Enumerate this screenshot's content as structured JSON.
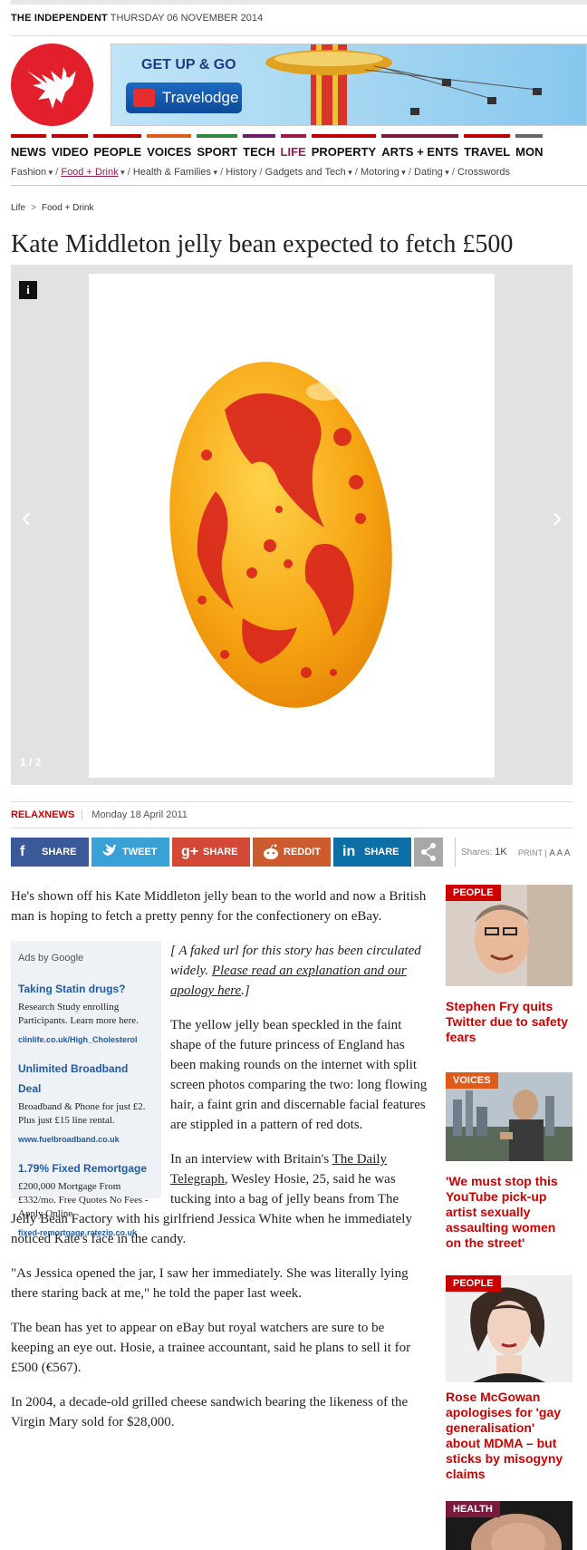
{
  "topbar": {
    "brand": "THE INDEPENDENT",
    "date": "THURSDAY 06 NOVEMBER 2014"
  },
  "ad_banner": {
    "headline": "GET UP & GO",
    "button": "Travelodge"
  },
  "main_nav": [
    "NEWS",
    "VIDEO",
    "PEOPLE",
    "VOICES",
    "SPORT",
    "TECH",
    "LIFE",
    "PROPERTY",
    "ARTS + ENTS",
    "TRAVEL",
    "MON"
  ],
  "nav_colors": [
    "#c00000",
    "#c00000",
    "#c00000",
    "#e05a1a",
    "#2c8a3c",
    "#6b1d6b",
    "#9b1a4b",
    "#c00000",
    "#7a1a3c",
    "#c00000",
    "#666666"
  ],
  "sub_nav": [
    "Fashion",
    "Food + Drink",
    "Health & Families",
    "History",
    "Gadgets and Tech",
    "Motoring",
    "Dating",
    "Crosswords"
  ],
  "sub_nav_dropdown": [
    true,
    true,
    true,
    false,
    true,
    true,
    true,
    false
  ],
  "breadcrumb": {
    "section": "Life",
    "sub": "Food + Drink"
  },
  "headline": "Kate Middleton jelly bean expected to fetch £500",
  "gallery": {
    "info": "i",
    "counter": "1 / 2"
  },
  "byline": {
    "source": "RELAXNEWS",
    "date": "Monday 18 April 2011"
  },
  "share": {
    "facebook": "SHARE",
    "twitter": "TWEET",
    "googleplus": "SHARE",
    "reddit": "REDDIT",
    "linkedin": "SHARE",
    "shares_label": "Shares:",
    "shares_count": "1K",
    "print": "PRINT",
    "text_size": "A A A"
  },
  "article": {
    "p1": "He's shown off his Kate Middleton jelly bean to the world and now a British man is hoping to fetch a pretty penny for the confectionery on eBay.",
    "note_pre": "[ A faked url for this story has been circulated widely. ",
    "note_link": "Please read an explanation and our apology here",
    "note_post": ".]",
    "p2": "The yellow jelly bean speckled in the faint shape of the future princess of England has been making rounds on the internet with split screen photos comparing the two: long flowing hair, a faint grin and discernable facial features are stippled in a pattern of red dots.",
    "p3_pre": "In an interview with Britain's ",
    "p3_link": "The Daily Telegraph",
    "p3_post": ", Wesley Hosie, 25, said he was tucking into a bag of jelly beans from The Jelly Bean Factory with his girlfriend Jessica White when he immediately noticed Kate's face in the candy.",
    "p4": "\"As Jessica opened the jar, I saw her immediately. She was literally lying there staring back at me,\" he told the paper last week.",
    "p5": "The bean has yet to appear on eBay but royal watchers are sure to be keeping an eye out. Hosie, a trainee accountant, said he plans to sell it for £500 (€567).",
    "p6": "In 2004, a decade-old grilled cheese sandwich bearing the likeness of the Virgin Mary sold for $28,000."
  },
  "google_ads": {
    "heading": "Ads by Google",
    "ads": [
      {
        "title": "Taking Statin drugs?",
        "body": "Research Study enrolling Participants. Learn more here.",
        "url": "clinlife.co.uk/High_Cholesterol"
      },
      {
        "title": "Unlimited Broadband Deal",
        "body": "Broadband & Phone for just £2. Plus just £15 line rental.",
        "url": "www.fuelbroadband.co.uk"
      },
      {
        "title": "1.79% Fixed Remortgage",
        "body": "£200,000 Mortgage From £332/mo. Free Quotes No Fees - Apply Online",
        "url": "fixed-remortgage.ratezip.co.uk"
      }
    ]
  },
  "sidebar": [
    {
      "tag": "PEOPLE",
      "title": "Stephen Fry quits Twitter due to safety fears"
    },
    {
      "tag": "VOICES",
      "title": "'We must stop this YouTube pick-up artist sexually assaulting women on the street'"
    },
    {
      "tag": "PEOPLE",
      "title": "Rose McGowan apologises for 'gay generalisation' about MDMA – but sticks by misogyny claims"
    },
    {
      "tag": "HEALTH",
      "title": ""
    }
  ]
}
